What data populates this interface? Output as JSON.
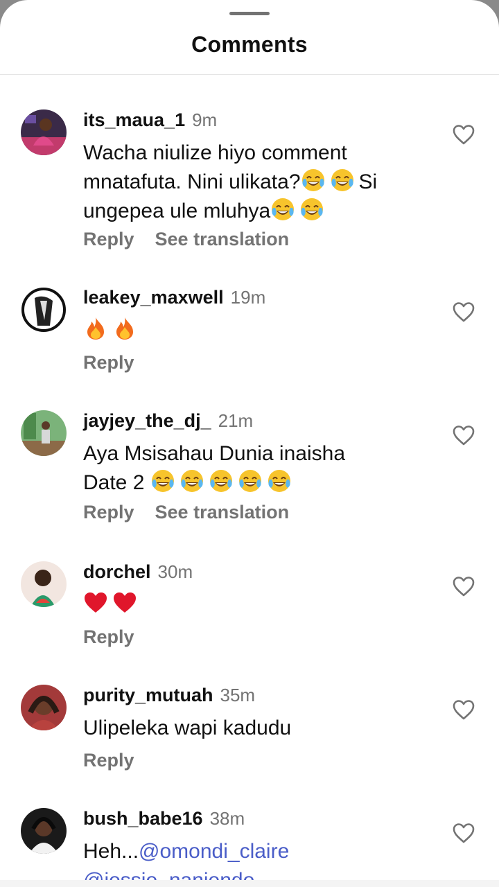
{
  "sheet": {
    "title": "Comments"
  },
  "comments": [
    {
      "username": "its_maua_1",
      "time": "9m",
      "lines": [
        "Wacha niulize hiyo comment",
        "mnatafuta. Nini ulikata?",
        "ungepea ule mluhya"
      ],
      "after_emoji_line2": "Si",
      "actions": [
        "Reply",
        "See translation"
      ],
      "avatar_icon": "profile-photo"
    },
    {
      "username": "leakey_maxwell",
      "time": "19m",
      "emojis": [
        "fire",
        "fire"
      ],
      "actions": [
        "Reply"
      ],
      "avatar_icon": "profile-photo"
    },
    {
      "username": "jayjey_the_dj_",
      "time": "21m",
      "lines": [
        "Aya Msisahau Dunia inaisha",
        "Date 2"
      ],
      "actions": [
        "Reply",
        "See translation"
      ],
      "avatar_icon": "profile-photo"
    },
    {
      "username": "dorchel",
      "time": "30m",
      "emojis": [
        "red-heart",
        "red-heart"
      ],
      "actions": [
        "Reply"
      ],
      "avatar_icon": "profile-photo"
    },
    {
      "username": "purity_mutuah",
      "time": "35m",
      "lines": [
        "Ulipeleka wapi kadudu"
      ],
      "actions": [
        "Reply"
      ],
      "avatar_icon": "profile-photo"
    },
    {
      "username": "bush_babe16",
      "time": "38m",
      "text_prefix": "Heh...",
      "mentions": [
        "@omondi_claire",
        "@jessie_naniendo"
      ],
      "avatar_icon": "profile-photo"
    }
  ],
  "colors": {
    "mention": "#4a5dc8",
    "secondary_text": "#737373"
  },
  "icons": {
    "like": "heart-outline-icon",
    "laughing": "face-with-tears-of-joy",
    "fire": "fire",
    "heart": "red-heart"
  }
}
